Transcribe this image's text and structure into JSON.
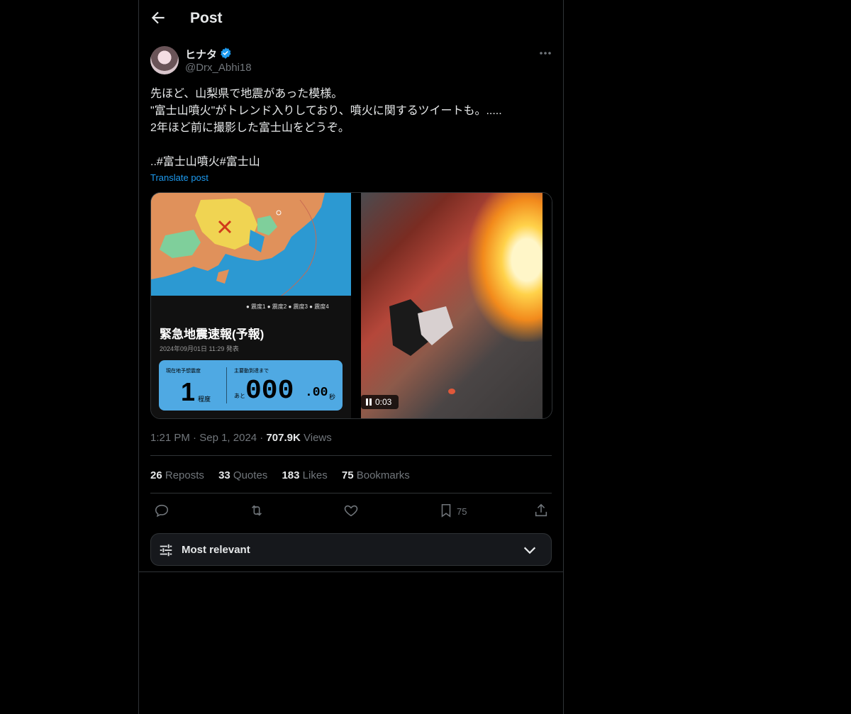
{
  "header": {
    "title": "Post"
  },
  "author": {
    "display_name": "ヒナタ",
    "handle": "@Drx_Abhi18"
  },
  "post": {
    "text": "先ほど、山梨県で地震があった模様。\n\"富士山噴火\"がトレンド入りしており、噴火に関するツイートも。.....\n2年ほど前に撮影した富士山をどうぞ。\n\n..#富士山噴火#富士山",
    "translate_label": "Translate post"
  },
  "media": {
    "legend": "● 震度1  ● 震度2  ● 震度3  ● 震度4",
    "alert_title": "緊急地震速報(予報)",
    "alert_date": "2024年09月01日 11:29 発表",
    "card_label_left": "現在地予想震度",
    "card_value_left": "1",
    "card_unit_left": "程度",
    "card_label_right": "主要動到達まで",
    "card_prefix_right": "あと",
    "card_value_right": "000",
    "card_decimal_right": ".00",
    "card_unit_right": "秒",
    "video_time": "0:03"
  },
  "meta": {
    "time": "1:21 PM",
    "date": "Sep 1, 2024",
    "views_count": "707.9K",
    "views_label": "Views"
  },
  "stats": {
    "reposts": {
      "count": "26",
      "label": "Reposts"
    },
    "quotes": {
      "count": "33",
      "label": "Quotes"
    },
    "likes": {
      "count": "183",
      "label": "Likes"
    },
    "bookmarks": {
      "count": "75",
      "label": "Bookmarks"
    }
  },
  "actions": {
    "bookmark_count": "75"
  },
  "sort": {
    "label": "Most relevant"
  },
  "colors": {
    "background": "#000000",
    "accent": "#1d9bf0",
    "muted": "#71767b",
    "border": "#2f3336"
  }
}
